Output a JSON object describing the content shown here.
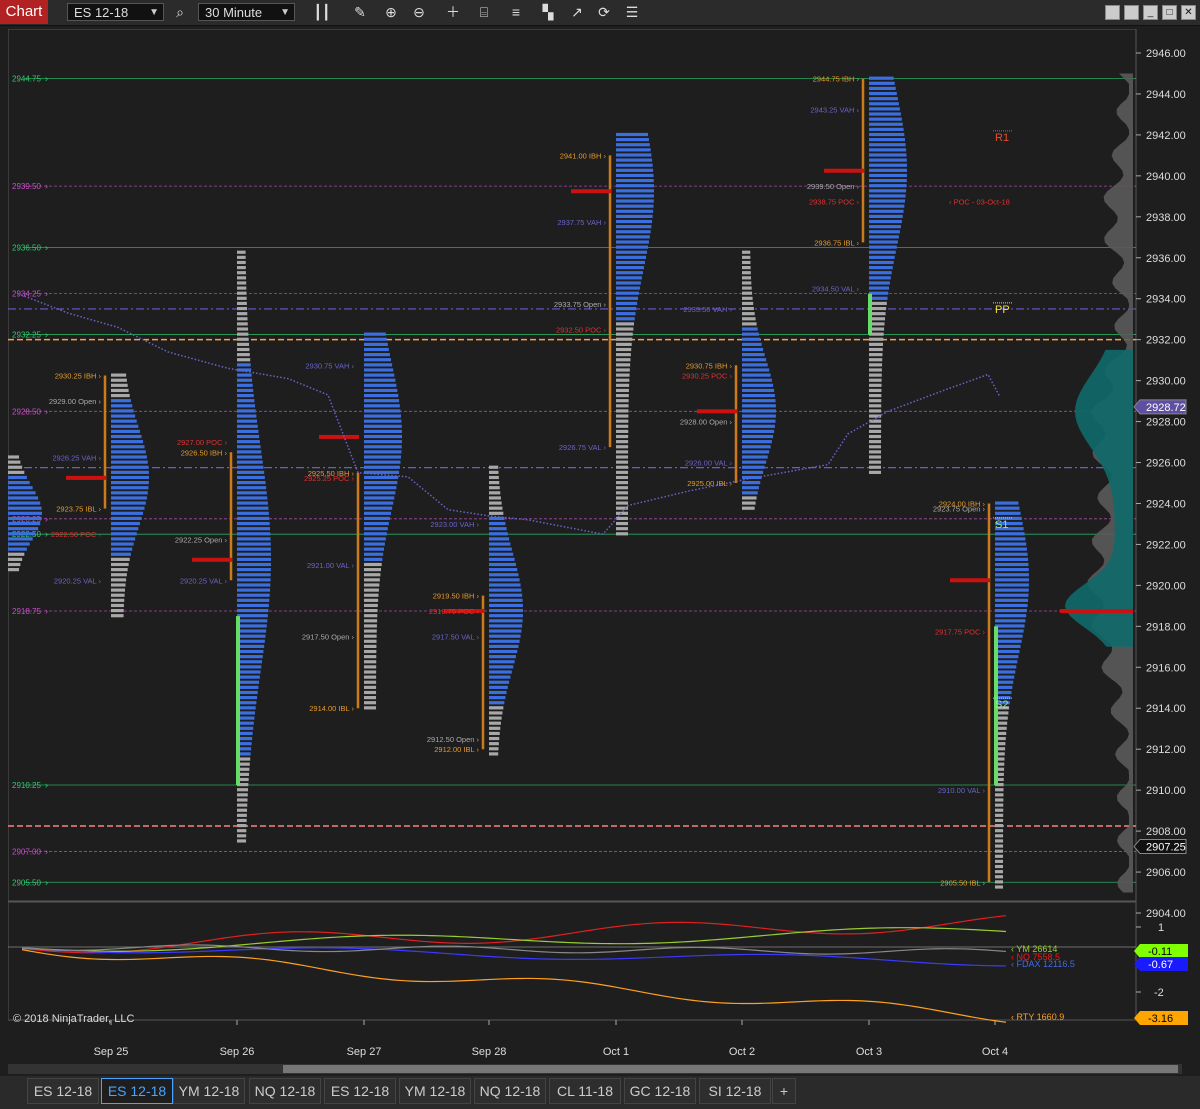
{
  "toolbar": {
    "chart_label": "Chart",
    "instrument": "ES 12-18",
    "interval": "30 Minute",
    "icons": [
      "candlestick-icon",
      "search-icon",
      "pencil-icon",
      "zoom-in-icon",
      "zoom-out-icon",
      "crosshair-icon",
      "properties-icon",
      "bar-settings-icon",
      "strategy-icon",
      "drawing-icon",
      "refresh-icon",
      "list-icon"
    ]
  },
  "window_buttons": [
    "minimize",
    "restore",
    "maximize",
    "close"
  ],
  "copyright": "© 2018 NinjaTrader, LLC",
  "tabs": [
    "ES 12-18",
    "ES 12-18",
    "YM 12-18",
    "NQ 12-18",
    "ES 12-18",
    "YM 12-18",
    "NQ 12-18",
    "CL 11-18",
    "GC 12-18",
    "SI 12-18"
  ],
  "active_tab": 1,
  "add_tab": "+",
  "chart_data": {
    "type": "market-profile",
    "instrument": "ES 12-18",
    "interval": "30 Minute",
    "y_axis": {
      "min": 2904,
      "max": 2946,
      "ticks": [
        "2946.00",
        "2944.00",
        "2942.00",
        "2940.00",
        "2938.00",
        "2936.00",
        "2934.00",
        "2932.00",
        "2930.00",
        "2928.00",
        "2926.00",
        "2924.00",
        "2922.00",
        "2920.00",
        "2918.00",
        "2916.00",
        "2914.00",
        "2912.00",
        "2910.00",
        "2908.00",
        "2906.00",
        "2904.00"
      ]
    },
    "x_axis": {
      "labels": [
        "Sep 25",
        "Sep 26",
        "Sep 27",
        "Sep 28",
        "Oct 1",
        "Oct 2",
        "Oct 3",
        "Oct 4"
      ]
    },
    "current_price": "2928.72",
    "last_price": "2907.25",
    "left_levels": [
      {
        "label": "2944.75",
        "price": 2944.75,
        "color": "#2ecc71",
        "style": "solid"
      },
      {
        "label": "2939.50",
        "price": 2939.5,
        "color": "#c850c8",
        "style": "dotted"
      },
      {
        "label": "2936.50",
        "price": 2936.5,
        "color": "#2ecc71",
        "style": "solid"
      },
      {
        "label": "2934.25",
        "price": 2934.25,
        "color": "#c850c8",
        "style": "dotted"
      },
      {
        "label": "2932.25",
        "price": 2932.25,
        "color": "#2ecc71",
        "style": "solid"
      },
      {
        "label": "2928.50",
        "price": 2928.5,
        "color": "#c850c8",
        "style": "dotted"
      },
      {
        "label": "2923.25",
        "price": 2923.25,
        "color": "#c850c8",
        "style": "dotted"
      },
      {
        "label": "2922.50",
        "price": 2922.5,
        "color": "#2ecc71",
        "style": "solid"
      },
      {
        "label": "2918.75",
        "price": 2918.75,
        "color": "#c850c8",
        "style": "dotted"
      },
      {
        "label": "2910.25",
        "price": 2910.25,
        "color": "#2ecc71",
        "style": "solid"
      },
      {
        "label": "2907.00",
        "price": 2907.0,
        "color": "#c850c8",
        "style": "dotted"
      },
      {
        "label": "2905.50",
        "price": 2905.5,
        "color": "#2ecc71",
        "style": "solid"
      }
    ],
    "orange_dashed_levels": [
      2932.0,
      2908.25
    ],
    "blue_dashdot_levels": [
      2933.5,
      2925.75
    ],
    "pivots": [
      {
        "label": "R1",
        "price": 2942.0,
        "color": "#e05030"
      },
      {
        "label": "PP",
        "price": 2933.6,
        "color": "#f0e040"
      },
      {
        "label": "S1",
        "price": 2923.1,
        "color": "#90ee90"
      },
      {
        "label": "S2",
        "price": 2914.3,
        "color": "#90ee90"
      }
    ],
    "sessions": [
      {
        "day": "Sep 24",
        "profile": [
          [
            2920.75,
            2926.25,
            "blue"
          ]
        ],
        "labels": []
      },
      {
        "day": "Sep 25",
        "profile": [
          [
            2918.5,
            2930.25,
            "mixed"
          ]
        ],
        "labels": [
          "2930.25 IBH",
          "2929.00 Open",
          "2926.25 VAH",
          "2923.75 IBL",
          "2922.50 POC",
          "2920.25 VAL"
        ],
        "ib": [
          2923.75,
          2930.25
        ],
        "poc": 2925.25
      },
      {
        "day": "Sep 26",
        "profile": [
          [
            2907.5,
            2936.25,
            "mixed"
          ]
        ],
        "labels": [
          "2927.00 POC",
          "2926.50 IBH",
          "2922.25 Open",
          "2920.25 VAL"
        ],
        "ib": [
          2920.25,
          2926.5
        ],
        "poc": 2921.25,
        "green_range": [
          2910.25,
          2918.5
        ]
      },
      {
        "day": "Sep 27",
        "profile": [
          [
            2914.0,
            2932.25,
            "mixed"
          ]
        ],
        "labels": [
          "2930.75 VAH",
          "2925.50 IBH",
          "2925.25 POC",
          "2921.00 VAL",
          "2917.50 Open",
          "2914.00 IBL"
        ],
        "ib": [
          2914.0,
          2925.5
        ],
        "poc": 2927.25
      },
      {
        "day": "Sep 28",
        "profile": [
          [
            2911.75,
            2925.75,
            "mixed"
          ]
        ],
        "labels": [
          "2923.00 VAH",
          "2919.50 IBH",
          "2918.75 POC",
          "2917.50 VAL",
          "2912.50 Open",
          "2912.00 IBL"
        ],
        "ib": [
          2912.0,
          2919.5
        ],
        "poc": 2918.75
      },
      {
        "day": "Oct 1",
        "profile": [
          [
            2922.5,
            2942.0,
            "mixed"
          ]
        ],
        "labels": [
          "2941.00 IBH",
          "2937.75 VAH",
          "2933.75 Open",
          "2932.50 POC",
          "2926.75 VAL"
        ],
        "ib": [
          2926.75,
          2941.0
        ],
        "poc": 2939.25
      },
      {
        "day": "Oct 2",
        "profile": [
          [
            2923.75,
            2936.25,
            "mixed"
          ]
        ],
        "labels": [
          "2933.50 VAH",
          "2930.75 IBH",
          "2930.25 POC",
          "2928.00 Open",
          "2926.00 VAL",
          "2925.00 IBL"
        ],
        "ib": [
          2925.0,
          2930.75
        ],
        "poc": 2928.5
      },
      {
        "day": "Oct 3",
        "profile": [
          [
            2925.5,
            2944.75,
            "mixed"
          ]
        ],
        "labels": [
          "2944.75 IBH",
          "2943.25 VAH",
          "2939.50 Open",
          "2938.75 POC",
          "2936.75 IBL",
          "2934.50 VAL"
        ],
        "ib": [
          2936.75,
          2944.75
        ],
        "poc": 2940.25,
        "green_range": [
          2932.25,
          2934.25
        ],
        "poc_ray_label": "POC - 03-Oct-18"
      },
      {
        "day": "Oct 4",
        "profile": [
          [
            2905.25,
            2924.0,
            "mixed"
          ]
        ],
        "labels": [
          "2924.00 IBH",
          "2923.75 Open",
          "2917.75 POC",
          "2910.00 VAL",
          "2905.50 IBL"
        ],
        "ib": [
          2905.5,
          2924.0
        ],
        "poc": 2920.25,
        "green_range": [
          2910.25,
          2918.0
        ]
      }
    ],
    "composite_poc": [
      2918.75
    ],
    "indicator_panel": {
      "ticks": [
        "1",
        "-2"
      ],
      "series": [
        {
          "name": "YM 26614",
          "value": "-0.11",
          "color": "#9acd32"
        },
        {
          "name": "NQ 7558.5",
          "value": "-0.67",
          "color": "#0000ff"
        },
        {
          "name": "FDAX 12116.5",
          "value": "",
          "color": "#4169e1"
        },
        {
          "name": "RTY 1660.9",
          "value": "-3.16",
          "color": "#ffa500"
        }
      ],
      "labels": [
        "YM 26614",
        "NQ 7558.5",
        "FDAX 12116.5",
        "RTY 1660.9"
      ]
    }
  }
}
